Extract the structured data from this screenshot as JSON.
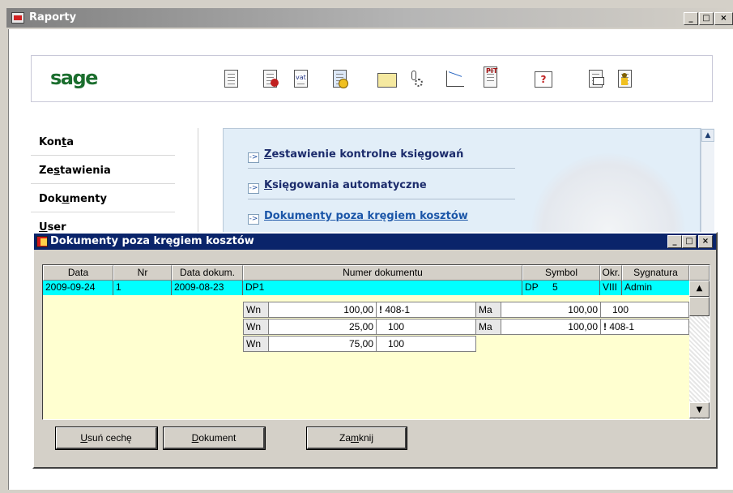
{
  "main_window": {
    "title": "Raporty",
    "controls": {
      "minimize": "_",
      "maximize": "□",
      "close": "×"
    }
  },
  "brand": {
    "logo": "sage",
    "color": "#1b6e2e"
  },
  "toolbar": {
    "icons": [
      "report-list-icon",
      "config-report-icon",
      "vat-report-icon",
      "alert-report-icon",
      "folder-icon",
      "tools-icon",
      "chart-icon",
      "pit-icon",
      "help-icon",
      "mail-icon",
      "person-icon"
    ],
    "labels": {
      "vat": "vat",
      "pit": "PIT",
      "help": "?"
    }
  },
  "nav": {
    "items": [
      {
        "pre": "Kon",
        "acc": "t",
        "post": "a"
      },
      {
        "pre": "Ze",
        "acc": "s",
        "post": "tawienia"
      },
      {
        "pre": "Dok",
        "acc": "u",
        "post": "menty"
      },
      {
        "pre": "",
        "acc": "U",
        "post": "ser"
      }
    ]
  },
  "panel": {
    "links": [
      {
        "acc": "Z",
        "rest": "estawienie kontrolne księgowań"
      },
      {
        "acc": "K",
        "rest": "sięgowania automatyczne"
      },
      {
        "acc": "D",
        "rest": "okumenty poza kręgiem kosztów"
      }
    ],
    "arrow": "->"
  },
  "dialog": {
    "title": "Dokumenty poza kręgiem kosztów",
    "columns": [
      "Data",
      "Nr",
      "Data dokum.",
      "Numer dokumentu",
      "Symbol",
      "Okr.",
      "Sygnatura"
    ],
    "selected_row": {
      "data": "2009-09-24",
      "nr": "1",
      "data_dokum": "2009-08-23",
      "numer": "DP1",
      "symbol": "DP",
      "symbol_nr": "5",
      "okr": "VIII",
      "sygnatura": "Admin"
    },
    "wn_entries": [
      {
        "side": "Wn",
        "amount": "100,00",
        "flag": "!",
        "account": "408-1"
      },
      {
        "side": "Wn",
        "amount": "25,00",
        "flag": "",
        "account": "100"
      },
      {
        "side": "Wn",
        "amount": "75,00",
        "flag": "",
        "account": "100"
      }
    ],
    "ma_entries": [
      {
        "side": "Ma",
        "amount": "100,00",
        "flag": "",
        "account": "100"
      },
      {
        "side": "Ma",
        "amount": "100,00",
        "flag": "!",
        "account": "408-1"
      }
    ],
    "buttons": {
      "remove": {
        "acc": "U",
        "rest": "suń cechę"
      },
      "document": {
        "acc": "D",
        "rest": "okument"
      },
      "close": {
        "pre": "Za",
        "acc": "m",
        "rest": "knij"
      }
    },
    "colors": {
      "selection": "#00ffff",
      "body": "#ffffd0",
      "titlebar": "#0a246a"
    }
  }
}
